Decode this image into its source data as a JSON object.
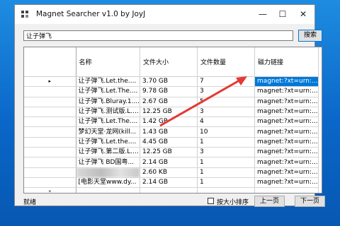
{
  "window": {
    "title": "Magnet Searcher v1.0 by JoyJ",
    "minimize_glyph": "—",
    "maximize_glyph": "☐",
    "close_glyph": "✕"
  },
  "search": {
    "query": "让子弹飞",
    "button_label": "搜索"
  },
  "table": {
    "columns": [
      "名称",
      "文件大小",
      "文件数量",
      "磁力链接"
    ],
    "current_row_marker": "▸",
    "new_row_marker": "*",
    "rows": [
      {
        "name": "让子弹飞.Let.the....",
        "size": "3.70 GB",
        "count": "7",
        "link": "magnet:?xt=urn:..."
      },
      {
        "name": "让子弹飞.Let.The....",
        "size": "9.78 GB",
        "count": "3",
        "link": "magnet:?xt=urn:..."
      },
      {
        "name": "让子弹飞.Bluray.1....",
        "size": "2.67 GB",
        "count": "5",
        "link": "magnet:?xt=urn:..."
      },
      {
        "name": "让子弹飞.测试版.L....",
        "size": "12.25 GB",
        "count": "3",
        "link": "magnet:?xt=urn:..."
      },
      {
        "name": "让子弹飞.Let.The....",
        "size": "1.42 GB",
        "count": "4",
        "link": "magnet:?xt=urn:..."
      },
      {
        "name": "梦幻天堂·龙网(kill...",
        "size": "1.43 GB",
        "count": "10",
        "link": "magnet:?xt=urn:..."
      },
      {
        "name": "让子弹飞.Let.the....",
        "size": "4.45 GB",
        "count": "1",
        "link": "magnet:?xt=urn:..."
      },
      {
        "name": "让子弹飞.第二版.L....",
        "size": "12.25 GB",
        "count": "3",
        "link": "magnet:?xt=urn:..."
      },
      {
        "name": "让子弹飞 BD国粤...",
        "size": "2.14 GB",
        "count": "1",
        "link": "magnet:?xt=urn:..."
      },
      {
        "name": "",
        "size": "2.60 KB",
        "count": "1",
        "link": "magnet:?xt=urn:..."
      },
      {
        "name": "[电影天堂www.dy...",
        "size": "2.14 GB",
        "count": "1",
        "link": "magnet:?xt=urn:..."
      }
    ]
  },
  "status": {
    "text": "就绪",
    "sort_by_size_label": "按大小排序",
    "sort_by_size_checked": false,
    "prev_page_label": "上一页",
    "next_page_label": "下一页"
  },
  "colors": {
    "selection": "#0078d7",
    "annotation_arrow": "#e53935"
  }
}
